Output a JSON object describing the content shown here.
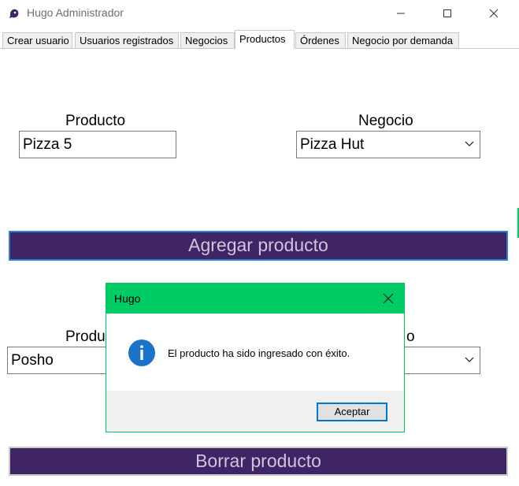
{
  "window": {
    "title": "Hugo Administrador"
  },
  "tabs": [
    {
      "label": "Crear usuario"
    },
    {
      "label": "Usuarios registrados"
    },
    {
      "label": "Negocios"
    },
    {
      "label": "Productos"
    },
    {
      "label": "Órdenes"
    },
    {
      "label": "Negocio por demanda"
    }
  ],
  "add_section": {
    "product_label": "Producto",
    "product_value": "Pizza 5",
    "business_label": "Negocio",
    "business_value": "Pizza Hut",
    "add_button": "Agregar producto"
  },
  "delete_section": {
    "product_label": "Produ",
    "product_value": "Posho",
    "business_label": "o",
    "business_value": "",
    "delete_button": "Borrar producto"
  },
  "dialog": {
    "title": "Hugo",
    "message": "El producto ha sido ingresado con éxito.",
    "ok_button": "Aceptar"
  },
  "colors": {
    "primary_button": "#3f2565",
    "dialog_titlebar": "#00cc66",
    "focus_border": "#2f7fd1"
  }
}
